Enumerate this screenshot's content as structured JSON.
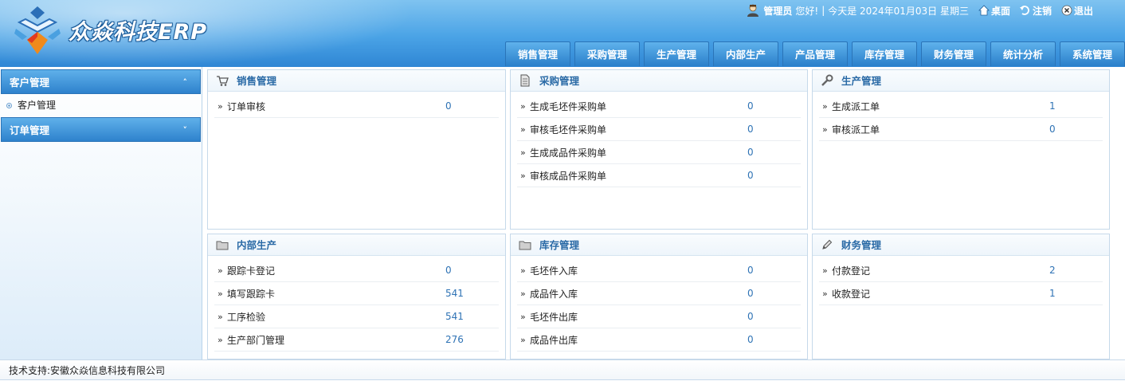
{
  "header": {
    "brand": "众焱科技ERP",
    "user": {
      "name": "管理员",
      "greeting": "您好!",
      "separator": "|",
      "date": "今天是 2024年01月03日 星期三",
      "desktop": "桌面",
      "logout_label": "注销",
      "exit_label": "退出"
    },
    "tabs": [
      "销售管理",
      "采购管理",
      "生产管理",
      "内部生产",
      "产品管理",
      "库存管理",
      "财务管理",
      "统计分析",
      "系统管理"
    ]
  },
  "sidebar": {
    "sections": [
      {
        "title": "客户管理",
        "chevron": "˄",
        "items": [
          "客户管理"
        ]
      },
      {
        "title": "订单管理",
        "chevron": "˅",
        "items": []
      }
    ]
  },
  "panels": [
    {
      "title": "销售管理",
      "icon": "cart-icon",
      "rows": [
        {
          "label": "订单审核",
          "value": "0"
        }
      ]
    },
    {
      "title": "采购管理",
      "icon": "document-icon",
      "rows": [
        {
          "label": "生成毛坯件采购单",
          "value": "0"
        },
        {
          "label": "审核毛坯件采购单",
          "value": "0"
        },
        {
          "label": "生成成品件采购单",
          "value": "0"
        },
        {
          "label": "审核成品件采购单",
          "value": "0"
        }
      ]
    },
    {
      "title": "生产管理",
      "icon": "wrench-icon",
      "rows": [
        {
          "label": "生成派工单",
          "value": "1"
        },
        {
          "label": "审核派工单",
          "value": "0"
        }
      ]
    },
    {
      "title": "内部生产",
      "icon": "folder-icon",
      "rows": [
        {
          "label": "跟踪卡登记",
          "value": "0"
        },
        {
          "label": "填写跟踪卡",
          "value": "541"
        },
        {
          "label": "工序检验",
          "value": "541"
        },
        {
          "label": "生产部门管理",
          "value": "276"
        }
      ]
    },
    {
      "title": "库存管理",
      "icon": "folder-icon",
      "rows": [
        {
          "label": "毛坯件入库",
          "value": "0"
        },
        {
          "label": "成品件入库",
          "value": "0"
        },
        {
          "label": "毛坯件出库",
          "value": "0"
        },
        {
          "label": "成品件出库",
          "value": "0"
        }
      ]
    },
    {
      "title": "财务管理",
      "icon": "pencil-icon",
      "rows": [
        {
          "label": "付款登记",
          "value": "2"
        },
        {
          "label": "收款登记",
          "value": "1"
        }
      ]
    }
  ],
  "footer": {
    "text": "技术支持:安徽众焱信息科技有限公司"
  },
  "colors": {
    "header_top": "#7fc3f0",
    "header_bottom": "#2f86d4",
    "accent": "#2f73b5"
  }
}
